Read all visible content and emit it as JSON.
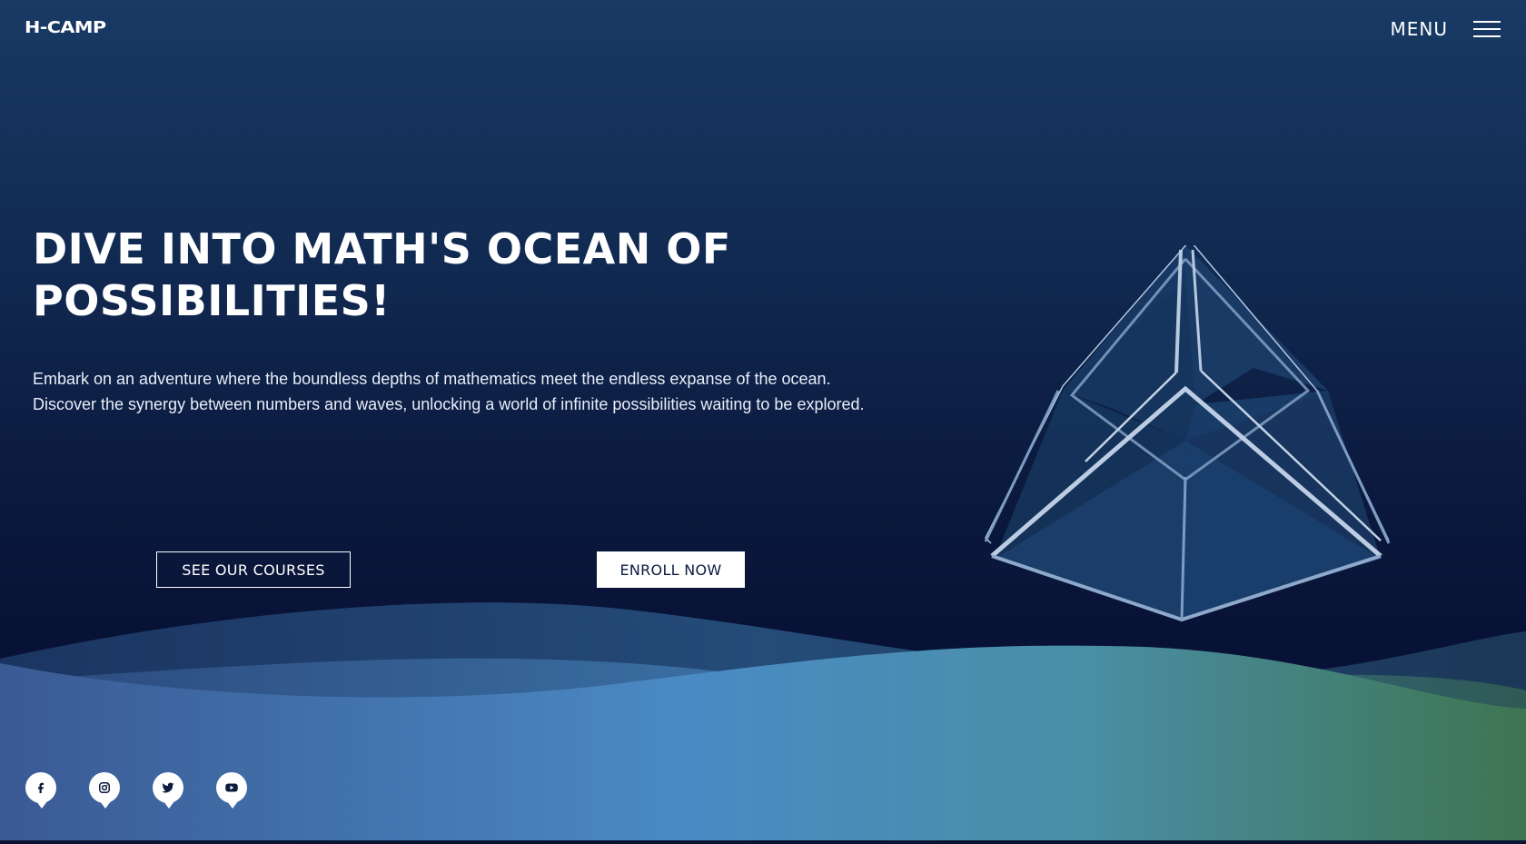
{
  "header": {
    "logo": "H-CAMP",
    "menu_label": "MENU"
  },
  "hero": {
    "title": "DIVE INTO MATH'S OCEAN OF POSSIBILITIES!",
    "description": "Embark on an adventure where the boundless depths of mathematics meet the endless expanse of the ocean. Discover the synergy between numbers and waves, unlocking a world of infinite possibilities waiting to be explored.",
    "buttons": {
      "courses": "SEE OUR COURSES",
      "enroll": "ENROLL NOW"
    }
  },
  "social": [
    "facebook-icon",
    "instagram-icon",
    "twitter-icon",
    "youtube-icon"
  ],
  "colors": {
    "background_top": "#183a64",
    "background_bottom": "#071035",
    "wave_blue": "#4a8ac4",
    "wave_green": "#3f7a55",
    "cube_stroke": "#a9bedb"
  }
}
